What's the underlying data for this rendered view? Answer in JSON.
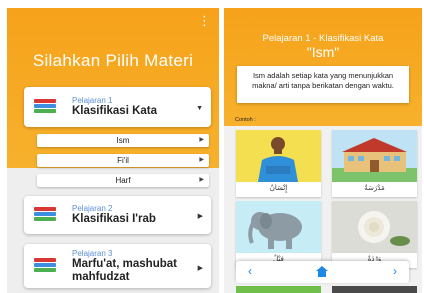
{
  "left": {
    "menu_icon": "more-vert-icon",
    "title": "Silahkan Pilih Materi",
    "lessons": [
      {
        "sub": "Pelajaran 1",
        "title": "Klasifikasi Kata",
        "icon": "books-icon",
        "expanded_icon": "caret-down-icon"
      },
      {
        "sub": "Pelajaran 2",
        "title": "Klasifikasi I'rab",
        "icon": "books-icon",
        "arrow_icon": "caret-right-icon"
      },
      {
        "sub": "Pelajaran 3",
        "title_line1": "Marfu'at, mashubat",
        "title_line2": "mahfudzat",
        "icon": "books-icon",
        "arrow_icon": "caret-right-icon"
      }
    ],
    "submenu": [
      "Ism",
      "Fi'il",
      "Harf"
    ]
  },
  "right": {
    "title": "Pelajaran 1 - Klasifikasi Kata",
    "word": "\"Ism\"",
    "definition": "Ism adalah setiap kata yang menunjukkan makna/ arti tanpa berikatan dengan waktu.",
    "example_label": "Contoh :",
    "examples": [
      {
        "caption": "إِنْسَانٌ",
        "image": "man-image"
      },
      {
        "caption": "مَدْرَسَةٌ",
        "image": "school-image"
      },
      {
        "caption": "فِيْلٌ",
        "image": "elephant-image"
      },
      {
        "caption": "وَرْدَةٌ",
        "image": "rose-image"
      }
    ],
    "nav": {
      "prev": "‹",
      "home": "home-icon",
      "next": "›"
    }
  },
  "colors": {
    "accent": "#f6a21a",
    "link": "#1e88e5"
  }
}
